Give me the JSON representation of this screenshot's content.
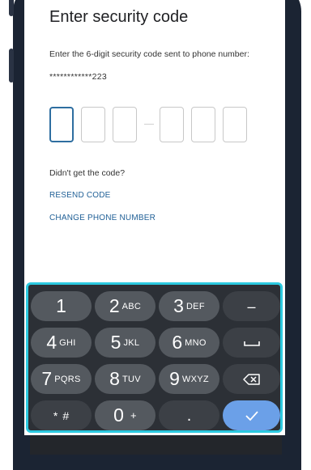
{
  "screen": {
    "title": "Enter security code",
    "instruction": "Enter the 6-digit security code sent to phone number:",
    "masked_phone": "************223",
    "code_digits": [
      "",
      "",
      "",
      "",
      "",
      ""
    ],
    "didnt_get": "Didn't get the code?",
    "resend_label": "RESEND CODE",
    "change_phone_label": "CHANGE PHONE NUMBER"
  },
  "keypad": {
    "accent_color": "#2bc9e0",
    "keys": [
      {
        "num": "1",
        "letters": ""
      },
      {
        "num": "2",
        "letters": "ABC"
      },
      {
        "num": "3",
        "letters": "DEF"
      },
      {
        "num": "–",
        "letters": ""
      },
      {
        "num": "4",
        "letters": "GHI"
      },
      {
        "num": "5",
        "letters": "JKL"
      },
      {
        "num": "6",
        "letters": "MNO"
      },
      {
        "num": "space-icon",
        "letters": ""
      },
      {
        "num": "7",
        "letters": "PQRS"
      },
      {
        "num": "8",
        "letters": "TUV"
      },
      {
        "num": "9",
        "letters": "WXYZ"
      },
      {
        "num": "backspace-icon",
        "letters": ""
      },
      {
        "num": "*",
        "letters": "#"
      },
      {
        "num": "0",
        "letters": "+"
      },
      {
        "num": ".",
        "letters": ""
      },
      {
        "num": "checkmark-icon",
        "letters": ""
      }
    ]
  }
}
